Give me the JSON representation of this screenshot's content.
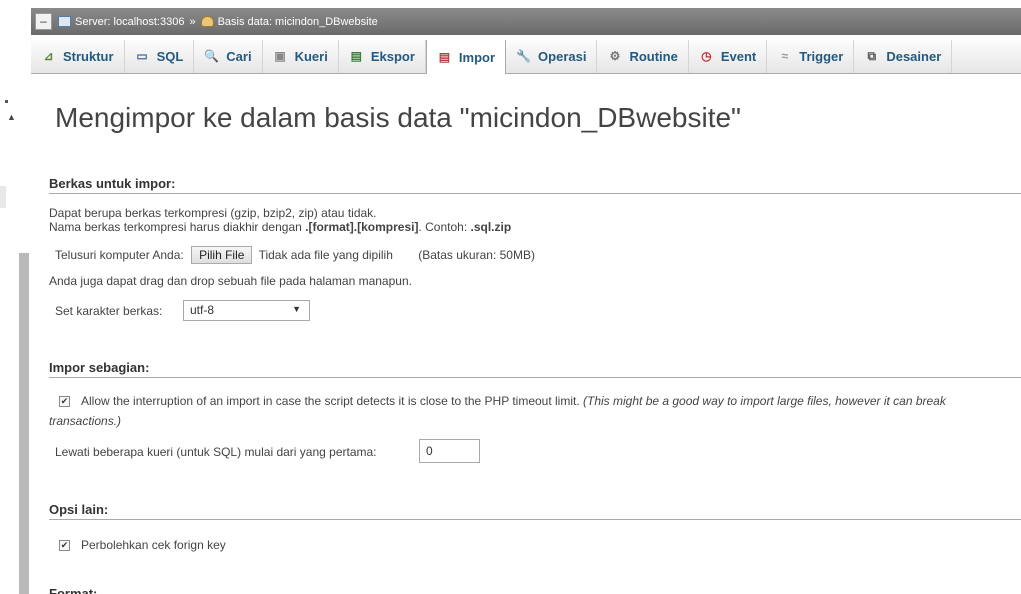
{
  "breadcrumb": {
    "server": "Server: localhost:3306",
    "separator": "»",
    "database": "Basis data: micindon_DBwebsite"
  },
  "tabs": [
    {
      "label": "Struktur",
      "icon": "structure-icon"
    },
    {
      "label": "SQL",
      "icon": "sql-icon"
    },
    {
      "label": "Cari",
      "icon": "search-icon"
    },
    {
      "label": "Kueri",
      "icon": "query-icon"
    },
    {
      "label": "Ekspor",
      "icon": "export-icon"
    },
    {
      "label": "Impor",
      "icon": "import-icon",
      "active": true
    },
    {
      "label": "Operasi",
      "icon": "wrench-icon"
    },
    {
      "label": "Routine",
      "icon": "routine-icon"
    },
    {
      "label": "Event",
      "icon": "clock-icon"
    },
    {
      "label": "Trigger",
      "icon": "trigger-icon"
    },
    {
      "label": "Desainer",
      "icon": "designer-icon"
    }
  ],
  "page_title": "Mengimpor ke dalam basis data \"micindon_DBwebsite\"",
  "file_section": {
    "title": "Berkas untuk impor:",
    "desc1": "Dapat berupa berkas terkompresi (gzip, bzip2, zip) atau tidak.",
    "desc2_prefix": "Nama berkas terkompresi harus diakhir dengan ",
    "desc2_format": ".[format].[kompresi]",
    "desc2_mid": ". Contoh: ",
    "desc2_example": ".sql.zip",
    "browse_label": "Telusuri komputer Anda:",
    "choose_button": "Pilih File",
    "no_file": "Tidak ada file yang dipilih",
    "max_size": "(Batas ukuran: 50MB)",
    "drag_hint": "Anda juga dapat drag dan drop sebuah file pada halaman manapun.",
    "charset_label": "Set karakter berkas:",
    "charset_value": "utf-8"
  },
  "partial_section": {
    "title": "Impor sebagian:",
    "allow_interrupt": "Allow the interruption of an import in case the script detects it is close to the PHP timeout limit.",
    "allow_interrupt_note": "(This might be a good way to import large files, however it can break",
    "allow_interrupt_note2": "transactions.)",
    "allow_interrupt_checked": true,
    "skip_label": "Lewati beberapa kueri (untuk SQL) mulai dari yang pertama:",
    "skip_value": "0"
  },
  "other_section": {
    "title": "Opsi lain:",
    "foreign_key_label": "Perbolehkan cek forign key",
    "foreign_key_checked": true
  },
  "format_section": {
    "title": "Format:"
  }
}
